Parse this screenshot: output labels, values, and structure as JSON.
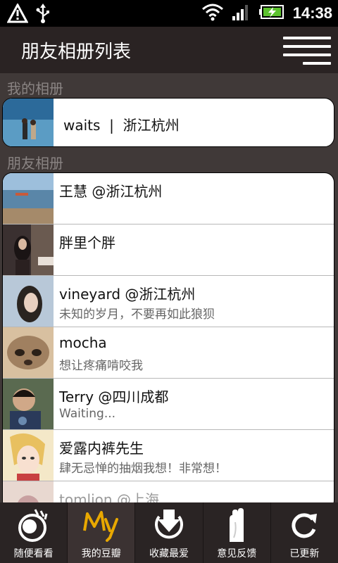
{
  "status_bar": {
    "time": "14:38"
  },
  "header": {
    "title": "朋友相册列表"
  },
  "my_albums": {
    "section_label": "我的相册",
    "owner": "waits  |  浙江杭州"
  },
  "friend_albums": {
    "section_label": "朋友相册",
    "items": [
      {
        "name": "王慧 @浙江杭州",
        "subtitle": ""
      },
      {
        "name": "胖里个胖",
        "subtitle": ""
      },
      {
        "name": "vineyard @浙江杭州",
        "subtitle": "未知的岁月，不要再如此狼狈"
      },
      {
        "name": "mocha",
        "subtitle": "想让疼痛啃咬我"
      },
      {
        "name": "Terry @四川成都",
        "subtitle": "Waiting..."
      },
      {
        "name": "爱露内裤先生",
        "subtitle": "肆无忌惮的抽烟我想！非常想！"
      },
      {
        "name": "tomlion @上海",
        "subtitle": ""
      }
    ]
  },
  "bottom_nav": [
    {
      "label": "随便看看"
    },
    {
      "label": "我的豆瓣"
    },
    {
      "label": "收藏最爱"
    },
    {
      "label": "意见反馈"
    },
    {
      "label": "已更新"
    }
  ],
  "colors": {
    "accent_gold": "#e8a800",
    "background": "#403938",
    "header": "#2a2323"
  }
}
